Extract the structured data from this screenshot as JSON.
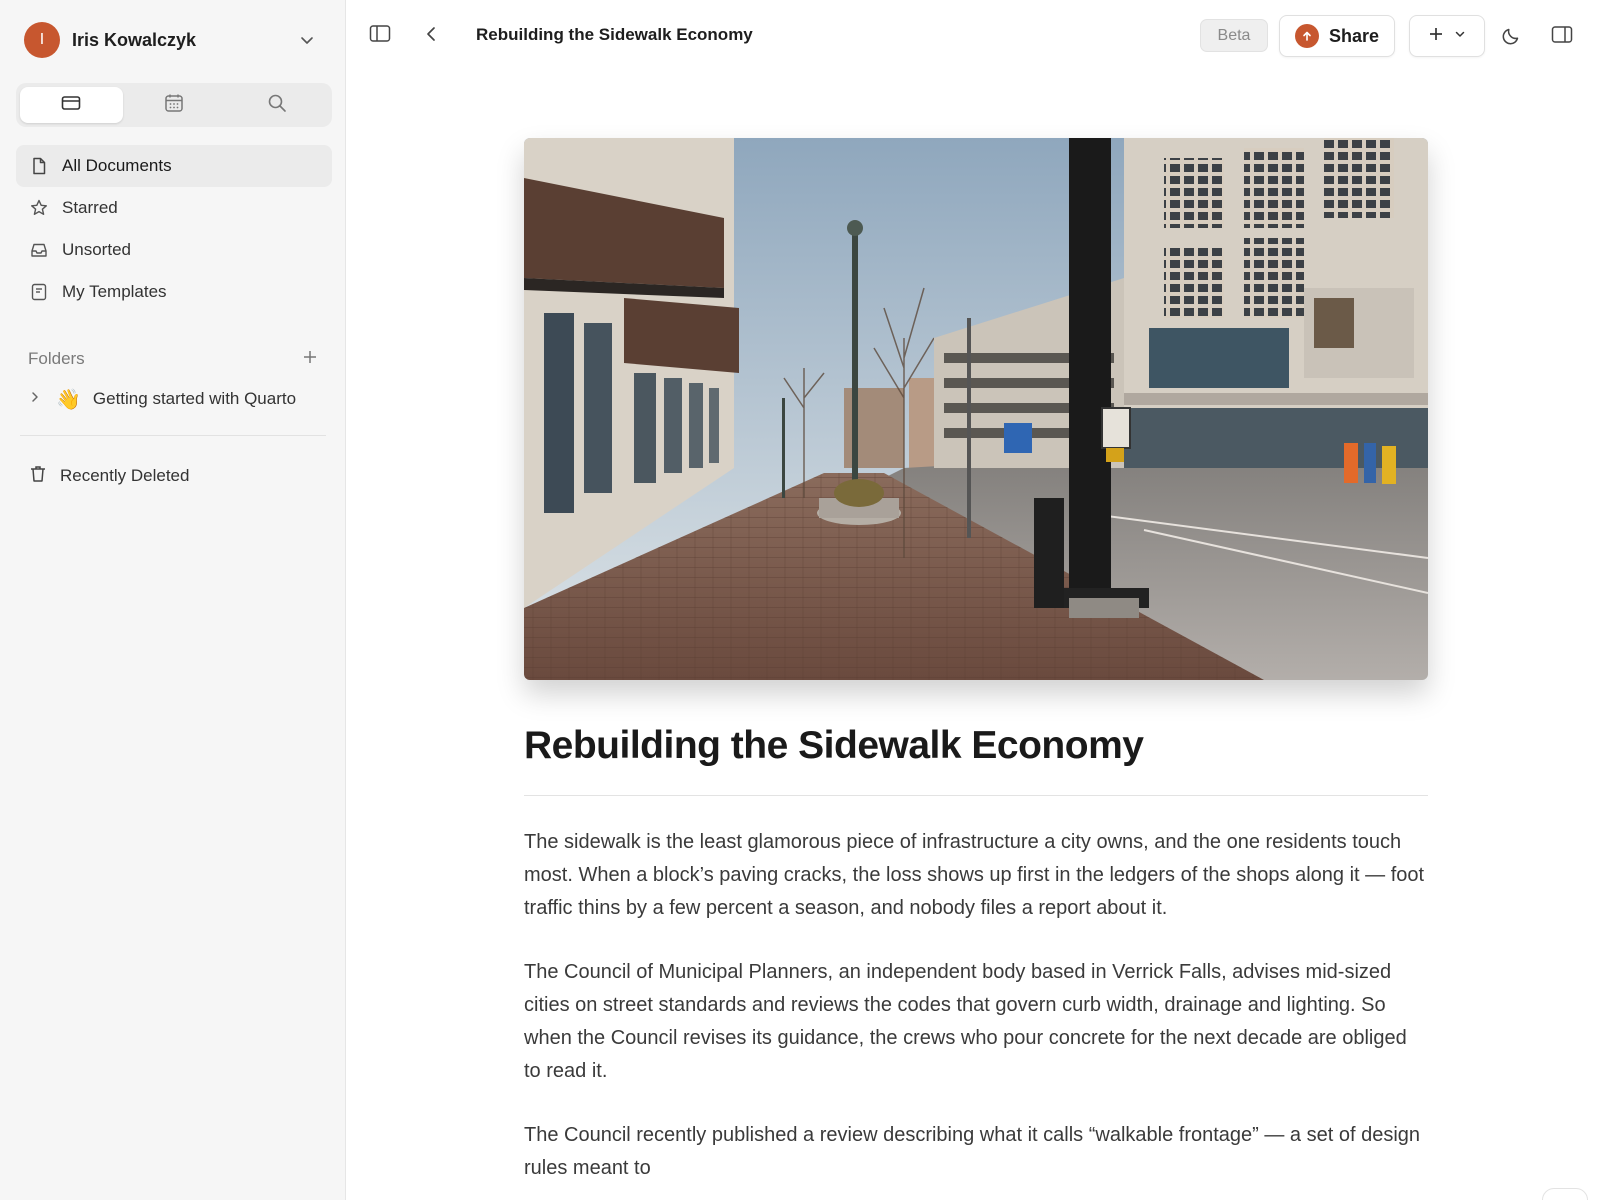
{
  "account": {
    "initial": "I",
    "name": "Iris Kowalczyk"
  },
  "sidebar": {
    "tabs": [
      {
        "icon": "cards-icon"
      },
      {
        "icon": "calendar-icon"
      },
      {
        "icon": "search-icon"
      }
    ],
    "nav": [
      {
        "label": "All Documents",
        "icon": "document-icon",
        "active": true
      },
      {
        "label": "Starred",
        "icon": "star-icon"
      },
      {
        "label": "Unsorted",
        "icon": "inbox-icon"
      },
      {
        "label": "My Templates",
        "icon": "template-icon"
      }
    ],
    "folders_label": "Folders",
    "folders": [
      {
        "emoji": "👋",
        "label": "Getting started with Quarto"
      }
    ],
    "recently_deleted": "Recently Deleted"
  },
  "toolbar": {
    "title": "Rebuilding the Sidewalk Economy",
    "beta": "Beta",
    "share": "Share"
  },
  "document": {
    "title": "Rebuilding the Sidewalk Economy",
    "paragraphs": [
      "The sidewalk is the least glamorous piece of infrastructure a city owns, and the one residents touch most. When a block’s paving cracks, the loss shows up first in the ledgers of the shops along it — foot traffic thins by a few percent a season, and nobody files a report about it.",
      "The Council of Municipal Planners, an independent body based in Verrick Falls, advises mid-sized cities on street standards and reviews the codes that govern curb width, drainage and lighting. So when the Council revises its guidance, the crews who pour concrete for the next decade are obliged to read it.",
      "The Council recently published a review describing what it calls “walkable frontage” — a set of design rules meant to"
    ]
  },
  "colors": {
    "accent": "#c7572f",
    "sidebar_bg": "#f6f6f6"
  }
}
